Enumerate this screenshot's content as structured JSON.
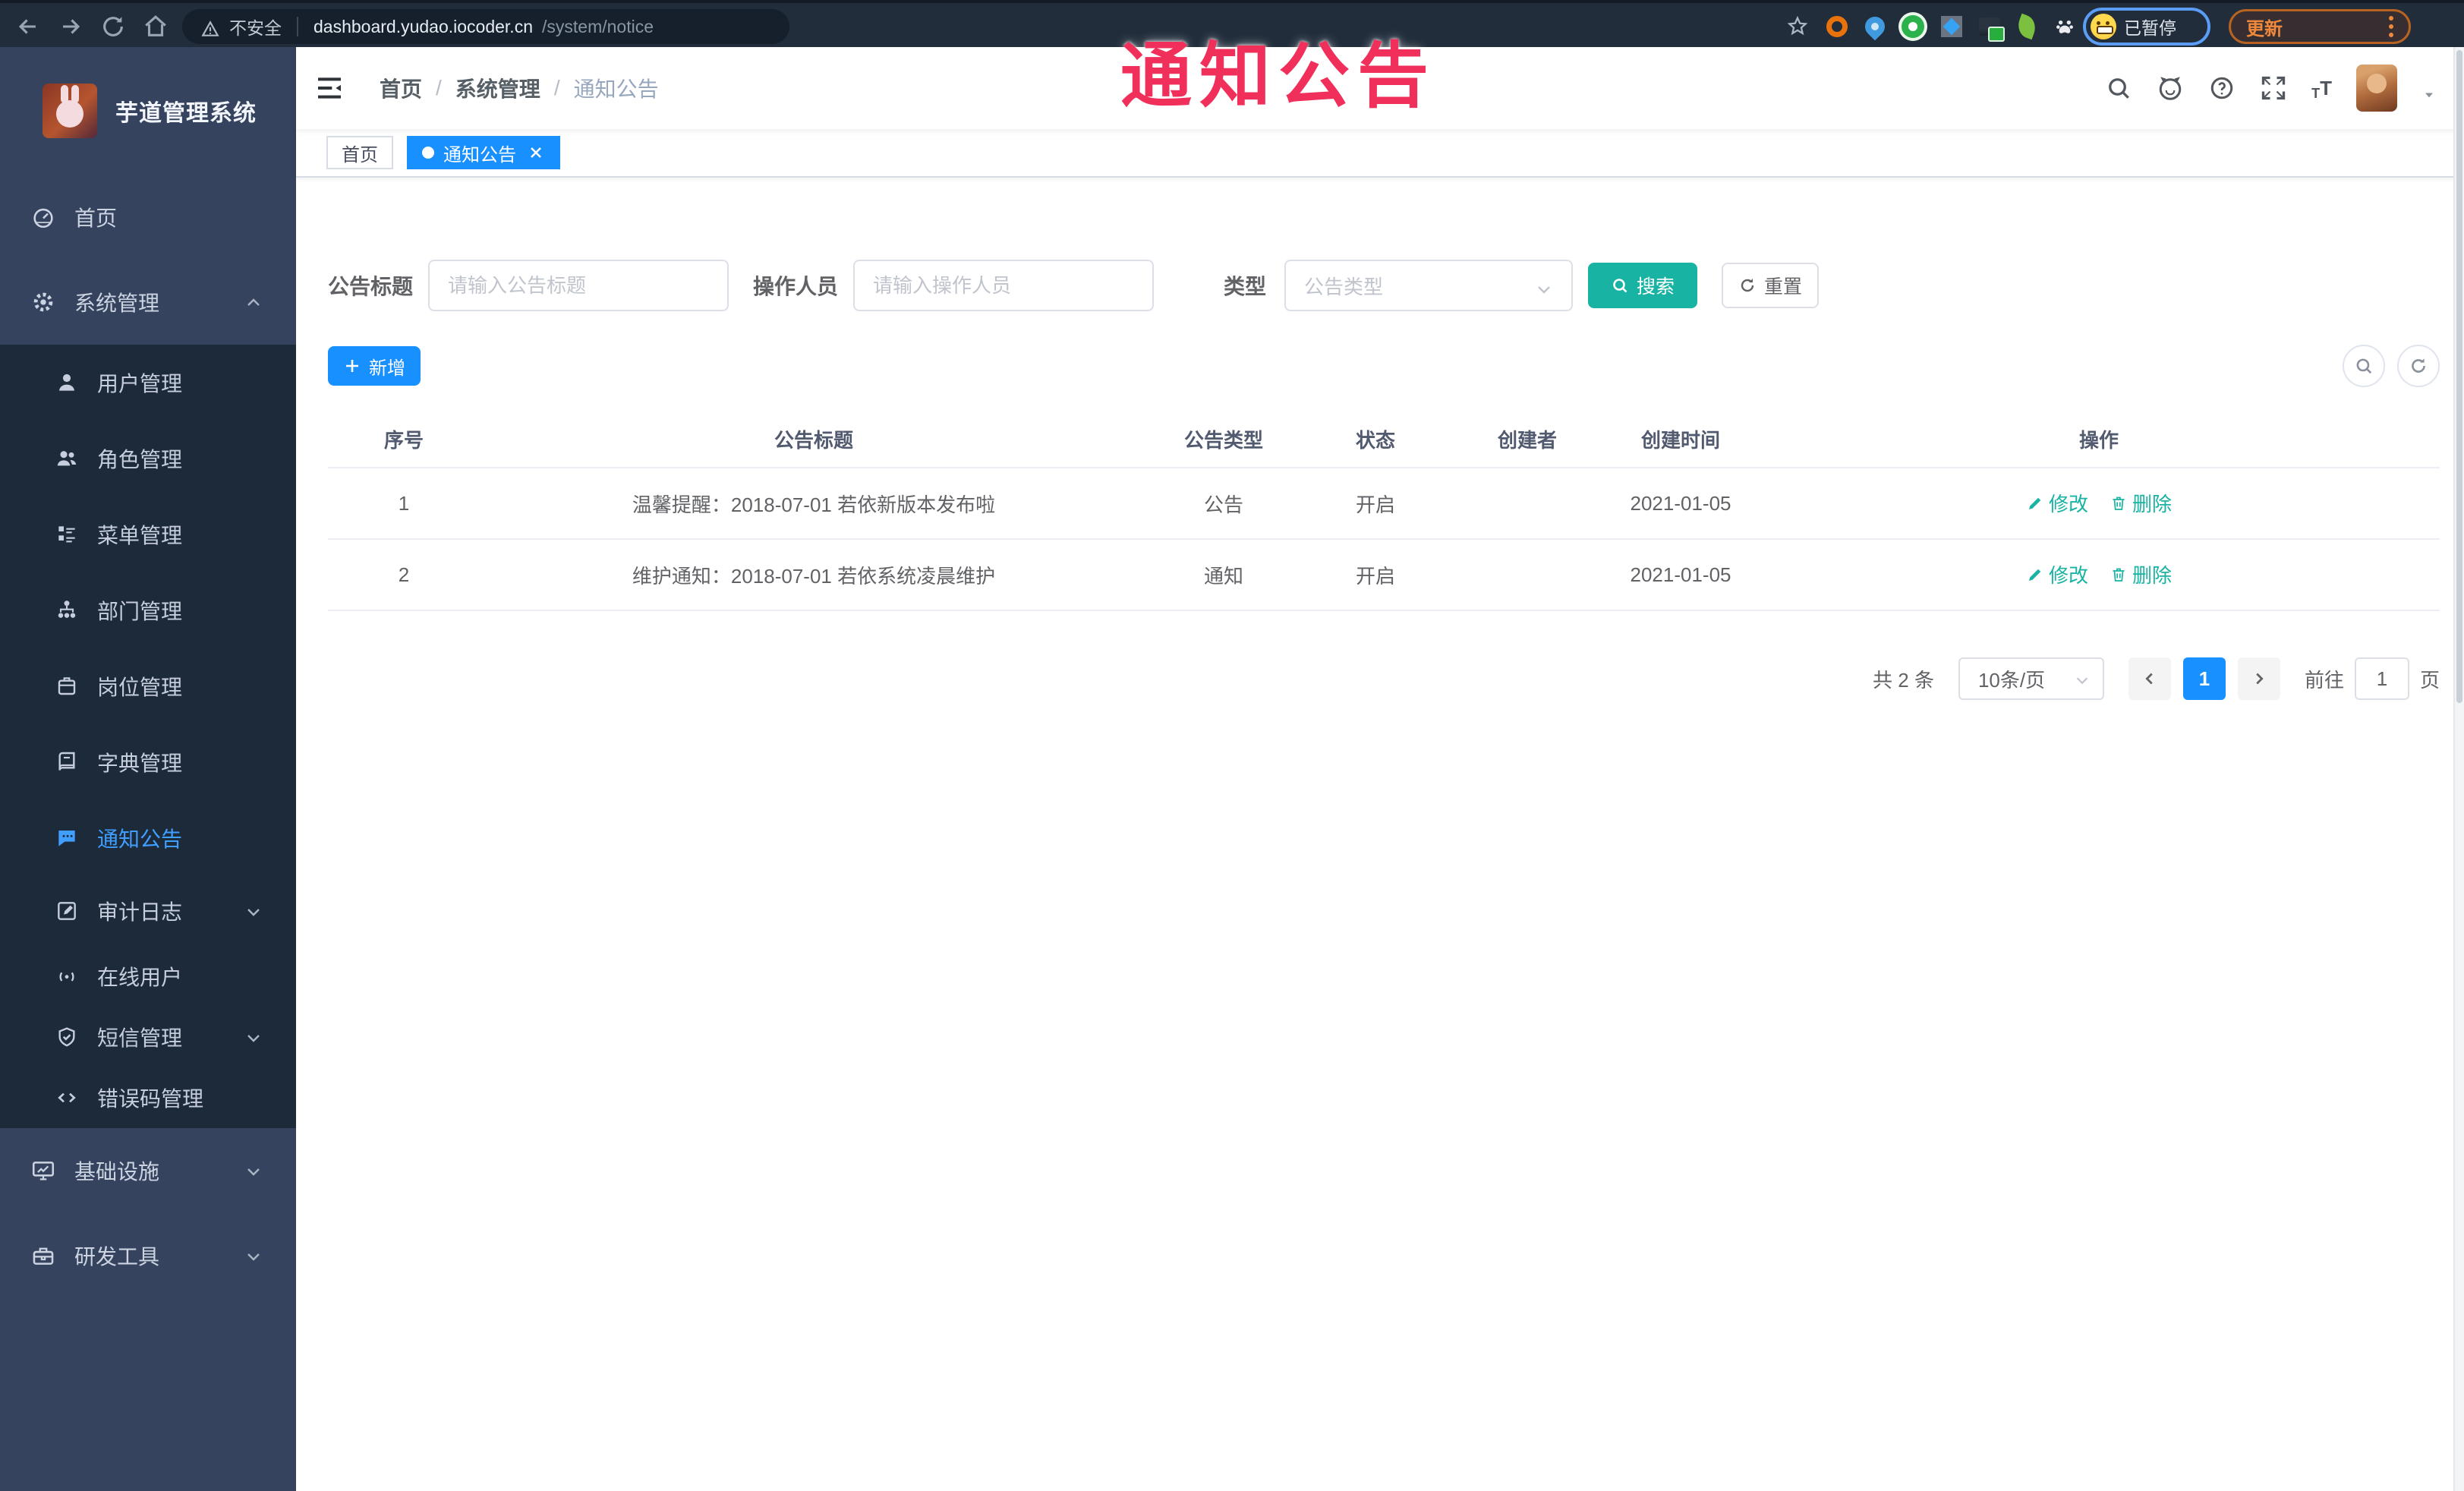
{
  "browser": {
    "security_label": "不安全",
    "url_domain": "dashboard.yudao.iocoder.cn",
    "url_path": "/system/notice",
    "extensions": [
      "bookmark-star-icon",
      "orange-ring-extension-icon",
      "blue-drop-extension-icon",
      "green-circle-extension-icon",
      "blue-diamond-extension-icon",
      "proxy-switch-extension-icon",
      "green-leaf-extension-icon",
      "paw-extension-icon"
    ],
    "profile_chip_label": "已暂停",
    "update_label": "更新"
  },
  "overlay_title": "通知公告",
  "sidebar": {
    "logo_title": "芋道管理系统",
    "items": [
      {
        "label": "首页",
        "icon": "gauge-icon",
        "level": "top"
      },
      {
        "label": "系统管理",
        "icon": "gear-icon",
        "level": "top",
        "caret": "up"
      },
      {
        "label": "用户管理",
        "icon": "user-icon",
        "level": "sub"
      },
      {
        "label": "角色管理",
        "icon": "users-icon",
        "level": "sub"
      },
      {
        "label": "菜单管理",
        "icon": "menu-list-icon",
        "level": "sub"
      },
      {
        "label": "部门管理",
        "icon": "org-tree-icon",
        "level": "sub"
      },
      {
        "label": "岗位管理",
        "icon": "id-badge-icon",
        "level": "sub"
      },
      {
        "label": "字典管理",
        "icon": "book-icon",
        "level": "sub"
      },
      {
        "label": "通知公告",
        "icon": "chat-bubble-icon",
        "level": "sub",
        "active": true
      },
      {
        "label": "审计日志",
        "icon": "edit-doc-icon",
        "level": "sub",
        "caret": "down"
      },
      {
        "label": "在线用户",
        "icon": "online-users-icon",
        "level": "sub"
      },
      {
        "label": "短信管理",
        "icon": "shield-check-icon",
        "level": "sub",
        "caret": "down"
      },
      {
        "label": "错误码管理",
        "icon": "code-icon",
        "level": "sub"
      },
      {
        "label": "基础设施",
        "icon": "monitor-icon",
        "level": "top",
        "caret": "down"
      },
      {
        "label": "研发工具",
        "icon": "toolbox-icon",
        "level": "top",
        "caret": "down"
      }
    ]
  },
  "navbar": {
    "breadcrumb": [
      "首页",
      "系统管理",
      "通知公告"
    ]
  },
  "tabs": [
    {
      "label": "首页",
      "active": false,
      "closable": false
    },
    {
      "label": "通知公告",
      "active": true,
      "closable": true
    }
  ],
  "filters": {
    "title_label": "公告标题",
    "title_placeholder": "请输入公告标题",
    "operator_label": "操作人员",
    "operator_placeholder": "请输入操作人员",
    "type_label": "类型",
    "type_placeholder": "公告类型",
    "search_label": "搜索",
    "reset_label": "重置"
  },
  "toolbar": {
    "add_label": "新增"
  },
  "table": {
    "columns": [
      "序号",
      "公告标题",
      "公告类型",
      "状态",
      "创建者",
      "创建时间",
      "操作"
    ],
    "rows": [
      {
        "no": "1",
        "title": "温馨提醒：2018-07-01 若依新版本发布啦",
        "type": "公告",
        "status": "开启",
        "creator": "",
        "created": "2021-01-05"
      },
      {
        "no": "2",
        "title": "维护通知：2018-07-01 若依系统凌晨维护",
        "type": "通知",
        "status": "开启",
        "creator": "",
        "created": "2021-01-05"
      }
    ],
    "edit_label": "修改",
    "delete_label": "删除"
  },
  "pagination": {
    "total_label": "共 2 条",
    "page_size": "10条/页",
    "current_page": "1",
    "goto_label": "前往",
    "goto_value": "1",
    "page_unit": "页"
  },
  "colors": {
    "accent_blue": "#1890ff",
    "teal_action": "#18b3a3",
    "overlay_red": "#f0305b",
    "sidebar_bg": "#36435e",
    "submenu_bg": "#1c2a3a",
    "active_menu": "#409eff"
  }
}
